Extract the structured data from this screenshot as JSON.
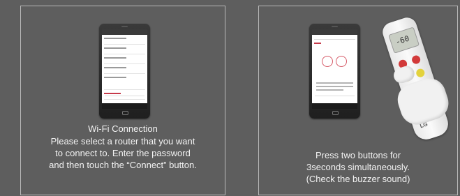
{
  "left_card": {
    "title": "Wi-Fi Connection",
    "lines": [
      "Please select a router that you want",
      "to connect to. Enter the password",
      "and then touch the “Connect” button."
    ]
  },
  "right_card": {
    "lines": [
      "Press two buttons for",
      "3seconds simultaneously.",
      "(Check the buzzer sound)"
    ]
  },
  "remote": {
    "display": "-60",
    "logo": "LG"
  },
  "colors": {
    "background": "#5e5e5e",
    "accent": "#c63a4a"
  }
}
